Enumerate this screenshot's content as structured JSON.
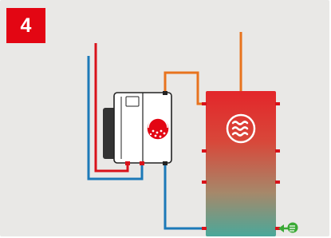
{
  "step": {
    "number": "4"
  },
  "colors": {
    "background": "#e9e8e6",
    "badge": "#e30613",
    "hot_pipe": "#d9121a",
    "cold_pipe": "#1c79b8",
    "flow_pipe": "#e8731e",
    "tank_top": "#e3262a",
    "tank_bottom": "#4aa89a",
    "heat_pump_body": "#ffffff",
    "heat_pump_outline": "#222222",
    "fan_grille": "#333333",
    "renewable_arrow": "#3aa935"
  },
  "icons": {
    "tank": "heat-waves-icon",
    "heat_pump": "heat-pump-emblem-icon",
    "renewable": "renewable-energy-arrow-icon"
  }
}
